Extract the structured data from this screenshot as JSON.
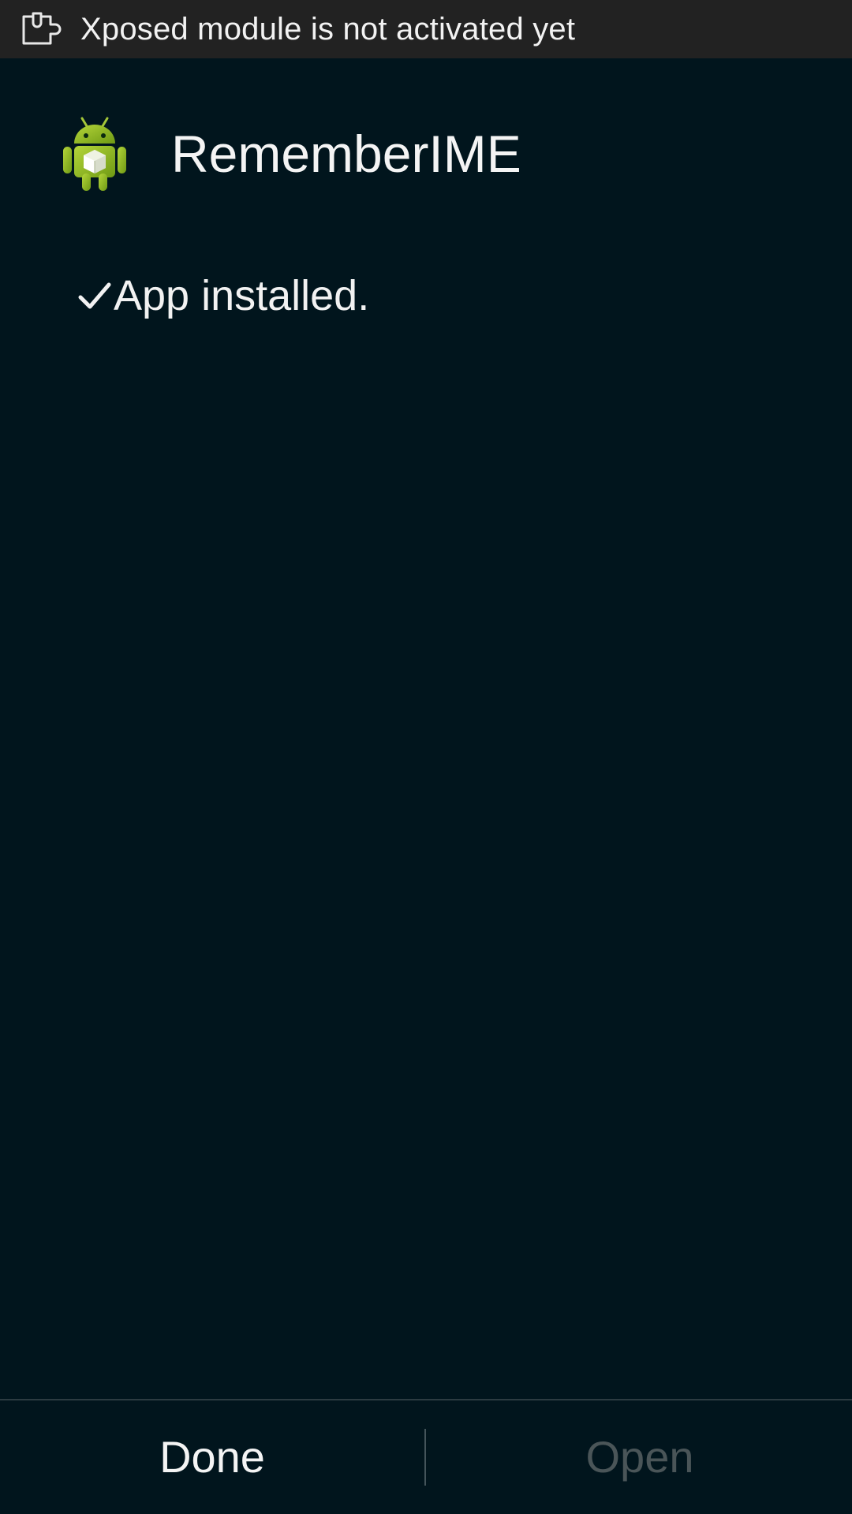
{
  "notification": {
    "icon": "puzzle-plug-icon",
    "text": "Xposed module is not activated yet"
  },
  "app": {
    "icon": "android-package-icon",
    "name": "RememberIME"
  },
  "install_status": {
    "icon": "checkmark-icon",
    "message": "App installed."
  },
  "actions": {
    "done_label": "Done",
    "open_label": "Open"
  },
  "colors": {
    "background": "#01151d",
    "status_bar": "#222222",
    "android_green": "#97c024",
    "disabled_text": "#4a5558"
  }
}
